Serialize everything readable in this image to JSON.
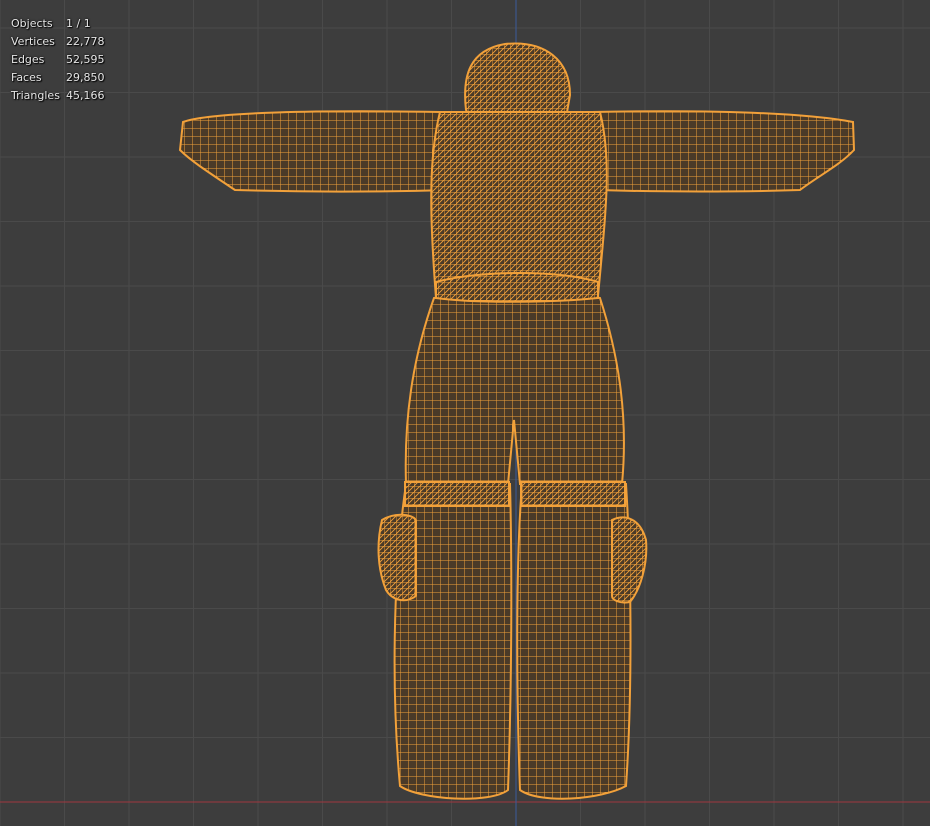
{
  "viewport": {
    "name": "3d-viewport",
    "view": "front-orthographic-wireframe",
    "colors": {
      "background": "#3d3d3d",
      "grid_line": "#4a4a4a",
      "x_axis": "#a0373f",
      "z_axis": "#3b5b9a",
      "mesh_wire": "#f2a13a"
    }
  },
  "statistics": {
    "rows": [
      {
        "label": "Objects",
        "value": "1 / 1"
      },
      {
        "label": "Vertices",
        "value": "22,778"
      },
      {
        "label": "Edges",
        "value": "52,595"
      },
      {
        "label": "Faces",
        "value": "29,850"
      },
      {
        "label": "Triangles",
        "value": "45,166"
      }
    ]
  }
}
